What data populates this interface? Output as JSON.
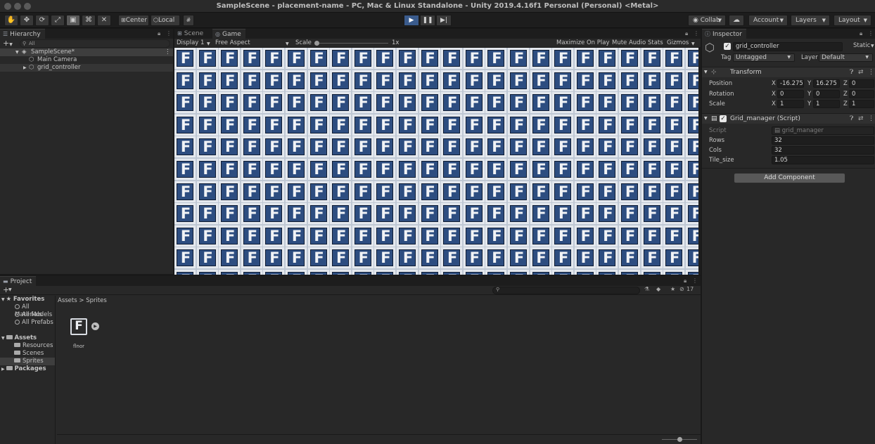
{
  "window": {
    "title": "SampleScene - placement-name - PC, Mac & Linux Standalone - Unity 2019.4.16f1 Personal (Personal) <Metal>"
  },
  "toolbar": {
    "pivot_label": "Center",
    "space_label": "Local",
    "collab_label": "Collab",
    "account_label": "Account",
    "layers_label": "Layers",
    "layout_label": "Layout"
  },
  "hierarchy": {
    "tab_label": "Hierarchy",
    "search_placeholder": "All",
    "items": [
      {
        "label": "SampleScene*"
      },
      {
        "label": "Main Camera"
      },
      {
        "label": "grid_controller"
      }
    ]
  },
  "gameview": {
    "tabs": [
      {
        "label": "Scene"
      },
      {
        "label": "Game"
      }
    ],
    "display_label": "Display 1",
    "aspect_label": "Free Aspect",
    "scale_label": "Scale",
    "scale_value": "1x",
    "maximize_label": "Maximize On Play",
    "mute_label": "Mute Audio",
    "stats_label": "Stats",
    "gizmos_label": "Gizmos",
    "tile_letter": "F",
    "tile_colors": {
      "border": "#e4e8ee",
      "fill": "#2d4d80"
    }
  },
  "inspector": {
    "tab_label": "Inspector",
    "object_name": "grid_controller",
    "static_label": "Static",
    "tag_label": "Tag",
    "tag_value": "Untagged",
    "layer_label": "Layer",
    "layer_value": "Default",
    "transform": {
      "title": "Transform",
      "position_label": "Position",
      "rotation_label": "Rotation",
      "scale_label": "Scale",
      "position": {
        "x": "-16.275",
        "y": "16.275",
        "z": "0"
      },
      "rotation": {
        "x": "0",
        "y": "0",
        "z": "0"
      },
      "scale": {
        "x": "1",
        "y": "1",
        "z": "1"
      }
    },
    "script_component": {
      "title": "Grid_manager (Script)",
      "script_label": "Script",
      "script_value": "grid_manager",
      "rows_label": "Rows",
      "rows_value": "32",
      "cols_label": "Cols",
      "cols_value": "32",
      "tile_size_label": "Tile_size",
      "tile_size_value": "1.05"
    },
    "add_component_label": "Add Component"
  },
  "project": {
    "tab_label": "Project",
    "favorites_label": "Favorites",
    "favorites": [
      {
        "label": "All Materials"
      },
      {
        "label": "All Models"
      },
      {
        "label": "All Prefabs"
      }
    ],
    "assets_label": "Assets",
    "asset_folders": [
      {
        "label": "Resources"
      },
      {
        "label": "Scenes"
      },
      {
        "label": "Sprites"
      }
    ],
    "packages_label": "Packages",
    "breadcrumb": {
      "root": "Assets",
      "separator": ">",
      "current": "Sprites"
    },
    "hidden_count": "17",
    "asset_items": [
      {
        "label": "flnor"
      }
    ]
  }
}
